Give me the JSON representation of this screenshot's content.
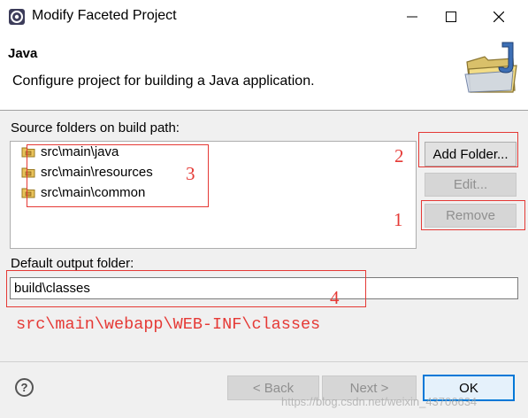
{
  "window": {
    "title": "Modify Faceted Project",
    "minimize_icon": "minimize-icon",
    "maximize_icon": "maximize-icon",
    "close_icon": "close-icon"
  },
  "header": {
    "title": "Java",
    "description": "Configure project for building a Java application."
  },
  "source_folders": {
    "label": "Source folders on build path:",
    "items": [
      "src\\main\\java",
      "src\\main\\resources",
      "src\\main\\common"
    ]
  },
  "buttons": {
    "add_folder": "Add Folder...",
    "edit": "Edit...",
    "remove": "Remove",
    "back": "< Back",
    "next": "Next >",
    "ok": "OK"
  },
  "output": {
    "label": "Default output folder:",
    "value": "build\\classes"
  },
  "annotations": {
    "n1": "1",
    "n2": "2",
    "n3": "3",
    "n4": "4",
    "path_note": "src\\main\\webapp\\WEB-INF\\classes",
    "color": "#e53935"
  },
  "watermark": "https://blog.csdn.net/weixin_43706634",
  "colors": {
    "accent": "#0078d7",
    "dialog_bg": "#f0f0f0"
  }
}
